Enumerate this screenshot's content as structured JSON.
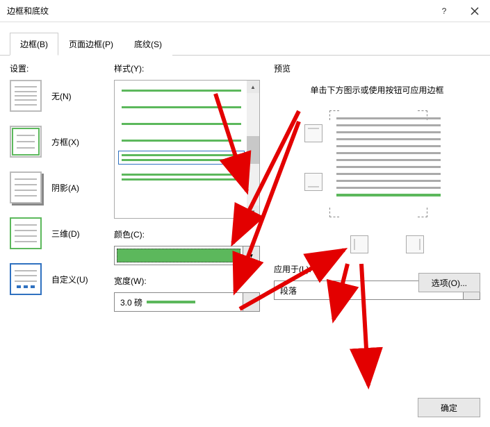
{
  "window": {
    "title": "边框和底纹"
  },
  "tabs": {
    "borders": "边框(B)",
    "page_borders": "页面边框(P)",
    "shading": "底纹(S)"
  },
  "settings": {
    "label": "设置:",
    "none": "无(N)",
    "box": "方框(X)",
    "shadow": "阴影(A)",
    "threed": "三维(D)",
    "custom": "自定义(U)"
  },
  "style": {
    "label": "样式(Y):",
    "color_label": "颜色(C):",
    "color_value": "#5cb85c",
    "width_label": "宽度(W):",
    "width_value": "3.0 磅"
  },
  "preview": {
    "label": "预览",
    "help": "单击下方图示或使用按钮可应用边框",
    "apply_label": "应用于(L):",
    "apply_value": "段落"
  },
  "buttons": {
    "options": "选项(O)...",
    "ok": "确定"
  }
}
